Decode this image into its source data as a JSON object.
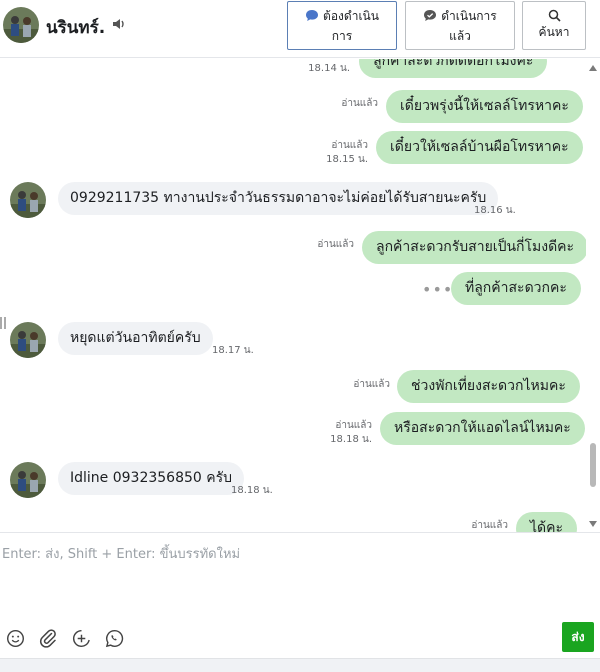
{
  "header": {
    "contact_name": "นรินทร์.",
    "btn_pending_line1": "ต้องดำเนิน",
    "btn_pending_line2": "การ",
    "btn_done_line1": "ดำเนินการ",
    "btn_done_line2": "แล้ว",
    "btn_search": "ค้นหา"
  },
  "messages": [
    {
      "dir": "out",
      "text": "ลูกค้าสะดวกติดต่อกี่โมงคะ",
      "time": "18.14 น."
    },
    {
      "dir": "out",
      "text": "เดี๋ยวพรุ่งนี้ให้เซลล์โทรหาคะ",
      "read": "อ่านแล้ว"
    },
    {
      "dir": "out",
      "text": "เดี๋ยวให้เซลล์บ้านผือโทรหาคะ",
      "read": "อ่านแล้ว",
      "time": "18.15 น."
    },
    {
      "dir": "in",
      "text": "0929211735 ทางานประจำวันธรรมดาอาจะไม่ค่อยได้รับสายนะครับ",
      "time": "18.16 น."
    },
    {
      "dir": "out",
      "text": "ลูกค้าสะดวกรับสายเป็นกี่โมงดีคะ",
      "read": "อ่านแล้ว"
    },
    {
      "dir": "out",
      "text": "ที่ลูกค้าสะดวกคะ",
      "typing": "•••"
    },
    {
      "dir": "in",
      "text": "หยุดแต่วันอาทิตย์ครับ",
      "time": "18.17 น."
    },
    {
      "dir": "out",
      "text": "ช่วงพักเที่ยงสะดวกไหมคะ",
      "read": "อ่านแล้ว"
    },
    {
      "dir": "out",
      "text": "หรือสะดวกให้แอดไลน์ไหมคะ",
      "read": "อ่านแล้ว",
      "time": "18.18 น."
    },
    {
      "dir": "in",
      "text": "Idline 0932356850 ครับ",
      "time": "18.18 น."
    },
    {
      "dir": "out",
      "text": "ได้คะ",
      "read": "อ่านแล้ว"
    }
  ],
  "composer": {
    "placeholder": "Enter: ส่ง, Shift + Enter: ขึ้นบรรทัดใหม่",
    "send_label": "ส่ง"
  },
  "icons": {
    "speaker": "speaker-icon",
    "pending": "chat-bubble-icon",
    "done": "chat-check-icon",
    "search": "search-icon",
    "emoji": "emoji-icon",
    "attach": "paperclip-icon",
    "add": "plus-circle-icon",
    "whatsapp": "phone-bubble-icon"
  },
  "colors": {
    "outgoing_bubble": "#c2e8c2",
    "incoming_bubble": "#f0f2f5",
    "send_button": "#1aa520",
    "pending_icon": "#4a76c9"
  }
}
